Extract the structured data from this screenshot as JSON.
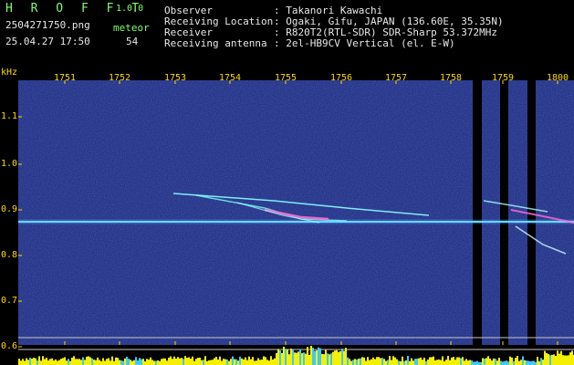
{
  "app": {
    "title": "H R O F F T",
    "version": "1.0.0"
  },
  "file": {
    "name": "2504271750.png",
    "datetime": "25.04.27 17:50"
  },
  "meteor": {
    "label": "meteor",
    "count": "54"
  },
  "info": [
    {
      "key": "Observer",
      "value": ": Takanori Kawachi"
    },
    {
      "key": "Receiving Location",
      "value": ": Ogaki, Gifu, JAPAN (136.60E, 35.35N)"
    },
    {
      "key": "Receiver",
      "value": ": R820T2(RTL-SDR) SDR-Sharp 53.372MHz"
    },
    {
      "key": "Receiving antenna",
      "value": ": 2el-HB9CV Vertical (el. E-W)"
    }
  ],
  "axis": {
    "unit": "kHz",
    "x_ticks": [
      "1751",
      "1752",
      "1753",
      "1754",
      "1755",
      "1756",
      "1757",
      "1758",
      "1759",
      "1800"
    ],
    "y_ticks": [
      "1.1",
      "1.0",
      "0.9",
      "0.8",
      "0.7",
      "0.6"
    ]
  },
  "colors": {
    "header_green": "#7dff6a",
    "axis_yellow": "#ffd800",
    "background_blue": "#1a2a8a"
  }
}
